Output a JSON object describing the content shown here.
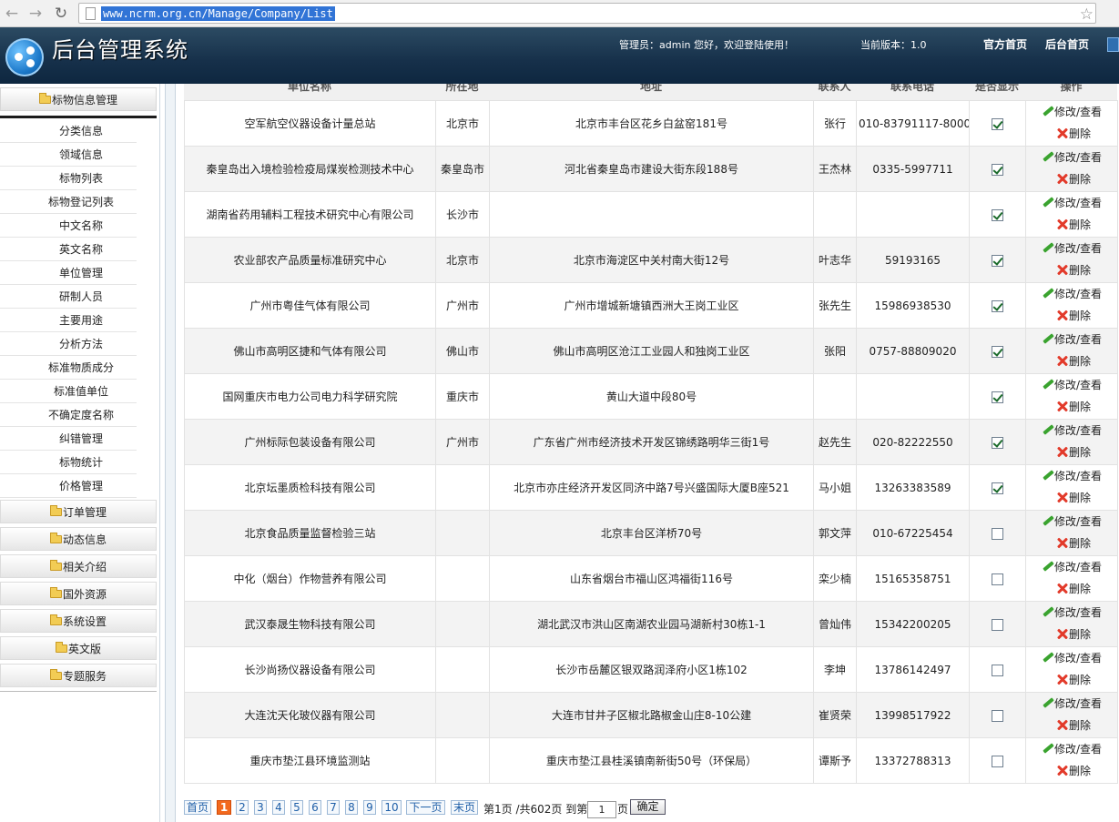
{
  "browser": {
    "url": "www.ncrm.org.cn/Manage/Company/List"
  },
  "header": {
    "title": "后台管理系统",
    "welcome": "管理员：admin 您好，欢迎登陆使用！",
    "version": "当前版本：1.0",
    "link_official": "官方首页",
    "link_backend": "后台首页"
  },
  "sidebar": {
    "head": "标物信息管理",
    "sub_items": [
      "分类信息",
      "领域信息",
      "标物列表",
      "标物登记列表",
      "中文名称",
      "英文名称",
      "单位管理",
      "研制人员",
      "主要用途",
      "分析方法",
      "标准物质成分",
      "标准值单位",
      "不确定度名称",
      "纠错管理",
      "标物统计",
      "价格管理"
    ],
    "groups": [
      "订单管理",
      "动态信息",
      "相关介绍",
      "国外资源",
      "系统设置",
      "英文版",
      "专题服务"
    ]
  },
  "table": {
    "columns": [
      "单位名称",
      "所在地",
      "地址",
      "联系人",
      "联系电话",
      "是否显示",
      "操作"
    ],
    "edit_label": "修改/查看",
    "delete_label": "删除",
    "rows": [
      {
        "name": "空军航空仪器设备计量总站",
        "city": "北京市",
        "address": "北京市丰台区花乡白盆窑181号",
        "contact": "张行",
        "phone": "010-83791117-8000",
        "shown": true
      },
      {
        "name": "秦皇岛出入境检验检疫局煤炭检测技术中心",
        "city": "秦皇岛市",
        "address": "河北省秦皇岛市建设大街东段188号",
        "contact": "王杰林",
        "phone": "0335-5997711",
        "shown": true
      },
      {
        "name": "湖南省药用辅料工程技术研究中心有限公司",
        "city": "长沙市",
        "address": "",
        "contact": "",
        "phone": "",
        "shown": true
      },
      {
        "name": "农业部农产品质量标准研究中心",
        "city": "北京市",
        "address": "北京市海淀区中关村南大街12号",
        "contact": "叶志华",
        "phone": "59193165",
        "shown": true
      },
      {
        "name": "广州市粤佳气体有限公司",
        "city": "广州市",
        "address": "广州市增城新塘镇西洲大王岗工业区",
        "contact": "张先生",
        "phone": "15986938530",
        "shown": true
      },
      {
        "name": "佛山市高明区捷和气体有限公司",
        "city": "佛山市",
        "address": "佛山市高明区沧江工业园人和独岗工业区",
        "contact": "张阳",
        "phone": "0757-88809020",
        "shown": true
      },
      {
        "name": "国网重庆市电力公司电力科学研究院",
        "city": "重庆市",
        "address": "黄山大道中段80号",
        "contact": "",
        "phone": "",
        "shown": true
      },
      {
        "name": "广州标际包装设备有限公司",
        "city": "广州市",
        "address": "广东省广州市经济技术开发区锦绣路明华三街1号",
        "contact": "赵先生",
        "phone": "020-82222550",
        "shown": true
      },
      {
        "name": "北京坛墨质检科技有限公司",
        "city": "",
        "address": "北京市亦庄经济开发区同济中路7号兴盛国际大厦B座521",
        "contact": "马小姐",
        "phone": "13263383589",
        "shown": true
      },
      {
        "name": "北京食品质量监督检验三站",
        "city": "",
        "address": "北京丰台区洋桥70号",
        "contact": "郭文萍",
        "phone": "010-67225454",
        "shown": false
      },
      {
        "name": "中化（烟台）作物营养有限公司",
        "city": "",
        "address": "山东省烟台市福山区鸿福街116号",
        "contact": "栾少楠",
        "phone": "15165358751",
        "shown": false
      },
      {
        "name": "武汉泰晟生物科技有限公司",
        "city": "",
        "address": "湖北武汉市洪山区南湖农业园马湖新村30栋1-1",
        "contact": "曾灿伟",
        "phone": "15342200205",
        "shown": false
      },
      {
        "name": "长沙尚扬仪器设备有限公司",
        "city": "",
        "address": "长沙市岳麓区银双路润泽府小区1栋102",
        "contact": "李坤",
        "phone": "13786142497",
        "shown": false
      },
      {
        "name": "大连沈天化玻仪器有限公司",
        "city": "",
        "address": "大连市甘井子区椒北路椒金山庄8-10公建",
        "contact": "崔贤荣",
        "phone": "13998517922",
        "shown": false
      },
      {
        "name": "重庆市垫江县环境监测站",
        "city": "",
        "address": "重庆市垫江县桂溪镇南新街50号（环保局）",
        "contact": "谭斯予",
        "phone": "13372788313",
        "shown": false
      }
    ]
  },
  "pager": {
    "first": "首页",
    "pages": [
      "1",
      "2",
      "3",
      "4",
      "5",
      "6",
      "7",
      "8",
      "9",
      "10"
    ],
    "current": "1",
    "next": "下一页",
    "last": "末页",
    "info": "第1页 /共602页 到第",
    "goto_value": "1",
    "page_suffix": "页",
    "confirm": "确定"
  }
}
